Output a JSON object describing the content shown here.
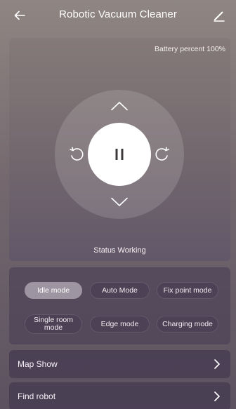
{
  "header": {
    "title": "Robotic Vacuum Cleaner",
    "back_icon": "arrow-left-icon",
    "edit_icon": "pencil-icon"
  },
  "control": {
    "battery_text": "Battery percent 100%",
    "status_text": "Status Working",
    "icons": {
      "up": "chevron-up-icon",
      "down": "chevron-down-icon",
      "left": "rotate-left-icon",
      "right": "rotate-right-icon",
      "center": "pause-icon"
    }
  },
  "modes": {
    "items": [
      {
        "label": "Idle mode",
        "active": true
      },
      {
        "label": "Auto Mode",
        "active": false
      },
      {
        "label": "Fix point mode",
        "active": false
      },
      {
        "label": "Single room mode",
        "active": false
      },
      {
        "label": "Edge mode",
        "active": false
      },
      {
        "label": "Charging mode",
        "active": false
      }
    ],
    "selected": "Idle mode"
  },
  "menu": {
    "items": [
      {
        "label": "Map Show",
        "icon": "chevron-right-icon"
      },
      {
        "label": "Find robot",
        "icon": "chevron-right-icon"
      }
    ]
  },
  "colors": {
    "active_mode": "#9d95a1",
    "text": "#ffffff"
  }
}
